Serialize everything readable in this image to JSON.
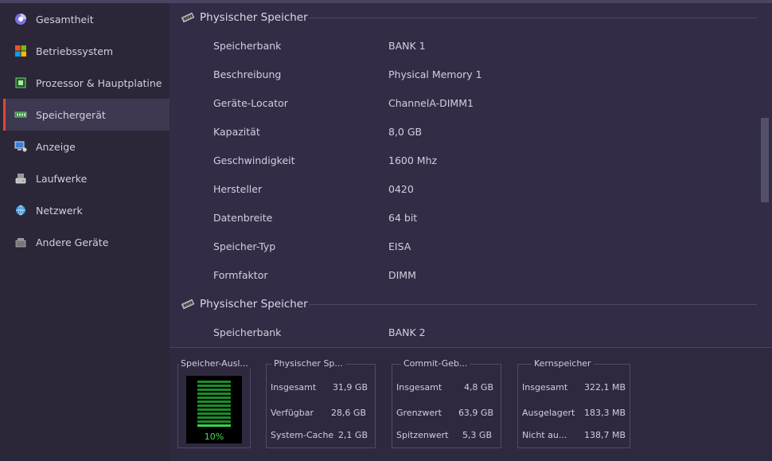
{
  "sidebar": {
    "items": [
      {
        "label": "Gesamtheit",
        "icon": "overview-icon"
      },
      {
        "label": "Betriebssystem",
        "icon": "windows-logo-icon"
      },
      {
        "label": "Prozessor & Hauptplatine",
        "icon": "cpu-chip-icon"
      },
      {
        "label": "Speichergerät",
        "icon": "ram-module-icon",
        "active": true
      },
      {
        "label": "Anzeige",
        "icon": "display-icon"
      },
      {
        "label": "Laufwerke",
        "icon": "drive-icon"
      },
      {
        "label": "Netzwerk",
        "icon": "network-icon"
      },
      {
        "label": "Andere Geräte",
        "icon": "device-icon"
      }
    ]
  },
  "main": {
    "sections": [
      {
        "title": "Physischer Speicher",
        "rows": [
          {
            "key": "Speicherbank",
            "value": "BANK 1"
          },
          {
            "key": "Beschreibung",
            "value": "Physical Memory 1"
          },
          {
            "key": "Geräte-Locator",
            "value": "ChannelA-DIMM1"
          },
          {
            "key": "Kapazität",
            "value": "8,0 GB"
          },
          {
            "key": "Geschwindigkeit",
            "value": "1600 Mhz"
          },
          {
            "key": "Hersteller",
            "value": "0420"
          },
          {
            "key": "Datenbreite",
            "value": "64 bit"
          },
          {
            "key": "Speicher-Typ",
            "value": "EISA"
          },
          {
            "key": "Formfaktor",
            "value": "DIMM"
          }
        ]
      },
      {
        "title": "Physischer Speicher",
        "rows": [
          {
            "key": "Speicherbank",
            "value": "BANK 2"
          }
        ]
      }
    ]
  },
  "footer": {
    "usage": {
      "title": "Speicher-Ausl...",
      "percent_label": "10%",
      "percent": 10
    },
    "physical": {
      "title": "Physischer Sp...",
      "rows": [
        {
          "key": "Insgesamt",
          "value": "31,9 GB"
        },
        {
          "key": "Verfügbar",
          "value": "28,6 GB"
        },
        {
          "key": "System-Cache",
          "value": "2,1 GB"
        }
      ]
    },
    "commit": {
      "title": "Commit-Geb...",
      "rows": [
        {
          "key": "Insgesamt",
          "value": "4,8 GB"
        },
        {
          "key": "Grenzwert",
          "value": "63,9 GB"
        },
        {
          "key": "Spitzenwert",
          "value": "5,3 GB"
        }
      ]
    },
    "kernel": {
      "title": "Kernspeicher",
      "rows": [
        {
          "key": "Insgesamt",
          "value": "322,1 MB"
        },
        {
          "key": "Ausgelagert",
          "value": "183,3 MB"
        },
        {
          "key": "Nicht au...",
          "value": "138,7 MB"
        }
      ]
    }
  },
  "colors": {
    "accent": "#e4463b",
    "gauge_green": "#38d449"
  }
}
